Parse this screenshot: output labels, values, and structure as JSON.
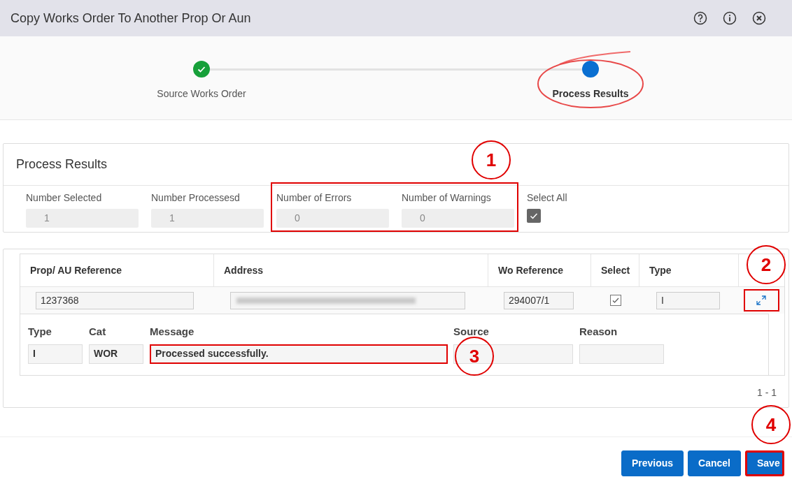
{
  "window": {
    "title": "Copy Works Order To Another Prop Or Aun"
  },
  "steps": [
    {
      "label": "Source Works Order",
      "completed": true,
      "selected": false
    },
    {
      "label": "Process Results",
      "completed": false,
      "selected": true
    }
  ],
  "summary": {
    "title": "Process Results",
    "fields": [
      {
        "label": "Number Selected",
        "value": "1",
        "highlighted": false
      },
      {
        "label": "Number Processesd",
        "value": "1",
        "highlighted": false
      },
      {
        "label": "Number of Errors",
        "value": "0",
        "highlighted": true
      },
      {
        "label": "Number of Warnings",
        "value": "0",
        "highlighted": true
      }
    ],
    "select_all": {
      "label": "Select All",
      "checked": true
    }
  },
  "table": {
    "columns": [
      "Prop/ AU Reference",
      "Address",
      "Wo Reference",
      "Select",
      "Type"
    ],
    "rows": [
      {
        "prop_reference": "1237368",
        "wo_reference": "294007/1",
        "selected": true,
        "type": "I",
        "expanded": true,
        "detail": {
          "fields": [
            {
              "label": "Type",
              "value": "I"
            },
            {
              "label": "Cat",
              "value": "WOR"
            },
            {
              "label": "Message",
              "value": "Processed successfully."
            },
            {
              "label": "Source"
            },
            {
              "label": "Reason"
            }
          ]
        }
      }
    ],
    "pagination": "1 - 1"
  },
  "buttons": [
    {
      "label": "Previous",
      "highlighted": false
    },
    {
      "label": "Cancel",
      "highlighted": false
    },
    {
      "label": "Save",
      "highlighted": true
    }
  ],
  "annotations": [
    {
      "label": "1"
    },
    {
      "label": "2"
    },
    {
      "label": "3"
    },
    {
      "label": "4"
    }
  ]
}
